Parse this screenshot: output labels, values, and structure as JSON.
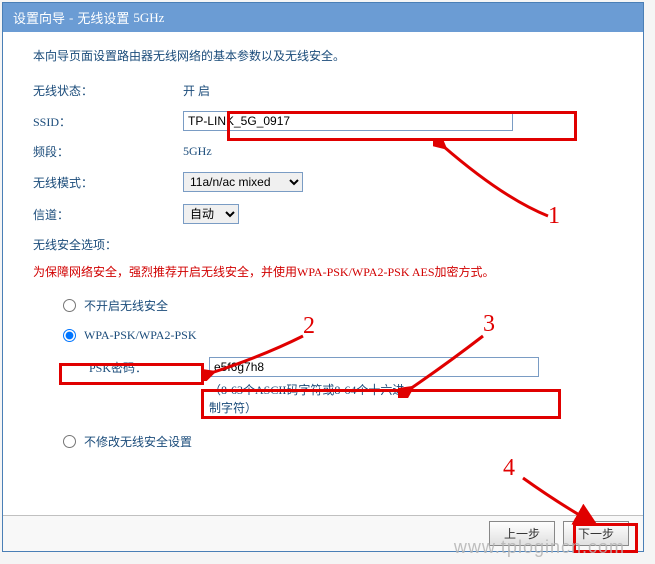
{
  "window": {
    "title_main": "设置向导",
    "title_sep": "-",
    "title_sub": "无线设置",
    "title_band": "5GHz"
  },
  "intro": "本向导页面设置路由器无线网络的基本参数以及无线安全。",
  "fields": {
    "wireless_status": {
      "label": "无线状态：",
      "value": "开 启"
    },
    "ssid": {
      "label": "SSID：",
      "value": "TP-LINK_5G_0917"
    },
    "band": {
      "label": "频段：",
      "value": "5GHz"
    },
    "mode": {
      "label": "无线模式：",
      "value": "11a/n/ac mixed"
    },
    "channel": {
      "label": "信道：",
      "value": "自动"
    }
  },
  "security": {
    "title": "无线安全选项：",
    "warning": "为保障网络安全，强烈推荐开启无线安全，并使用WPA-PSK/WPA2-PSK AES加密方式。",
    "opt_none": "不开启无线安全",
    "opt_wpa": "WPA-PSK/WPA2-PSK",
    "psk_label": "PSK密码：",
    "psk_value": "e5f6g7h8",
    "psk_hint": "（8-63个ASCII码字符或8-64个十六进制字符）",
    "opt_keep": "不修改无线安全设置"
  },
  "buttons": {
    "prev": "上一步",
    "next": "下一步"
  },
  "annotations": {
    "n1": "1",
    "n2": "2",
    "n3": "3",
    "n4": "4"
  },
  "watermark": "www.tplogincn.com"
}
